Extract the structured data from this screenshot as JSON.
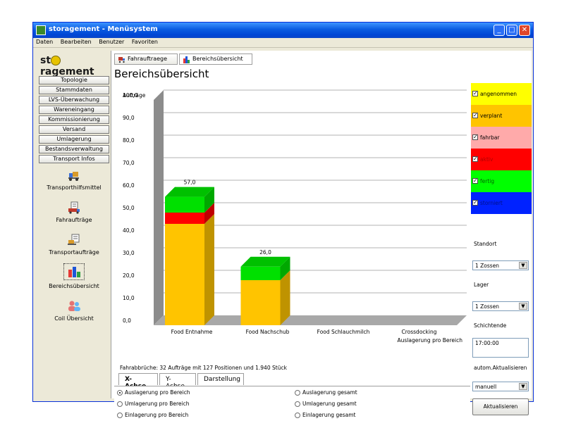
{
  "window": {
    "title": "storagement - Menüsystem",
    "minimize": "_",
    "maximize": "□",
    "close": "✕"
  },
  "menu": [
    "Daten",
    "Bearbeiten",
    "Benutzer",
    "Favoriten"
  ],
  "logo": {
    "text_left": "st",
    "text_right": "ragement"
  },
  "sidebar": {
    "buttons": [
      "Topologie",
      "Stammdaten",
      "LVS-Überwachung",
      "Wareneingang",
      "Kommissionierung",
      "Versand",
      "Umlagerung",
      "Bestandsverwaltung",
      "Transport Infos"
    ],
    "icon_items": [
      "Transporthilfsmittel",
      "Fahraufträge",
      "Transportaufträge",
      "Bereichsübersicht",
      "Coil Übersicht"
    ]
  },
  "tabs": [
    "Fahrauftraege",
    "Bereichsübersicht"
  ],
  "page_title": "Bereichsübersicht",
  "chart_data": {
    "type": "bar",
    "stacked": true,
    "ylabel": "Aufträge",
    "ylim": [
      0,
      100
    ],
    "yticks": [
      "0,0",
      "10,0",
      "20,0",
      "30,0",
      "40,0",
      "50,0",
      "60,0",
      "70,0",
      "80,0",
      "90,0",
      "100,0"
    ],
    "categories": [
      "Food Entnahme",
      "Food Nachschub",
      "Food Schlauchmilch",
      "Crossdocking"
    ],
    "x_axis_title": "Auslagerung pro Bereich",
    "totals": [
      "57,0",
      "26,0",
      "",
      ""
    ],
    "series": [
      {
        "name": "verplant",
        "color": "#ffc400",
        "values": [
          45,
          20,
          0,
          0
        ]
      },
      {
        "name": "aktiv",
        "color": "#ff0000",
        "values": [
          5,
          0,
          0,
          0
        ]
      },
      {
        "name": "fertig",
        "color": "#00e000",
        "values": [
          7,
          6,
          0,
          0
        ]
      }
    ],
    "grid": true,
    "legend_position": "right"
  },
  "footnote": "Fahrabbrüche: 32 Aufträge mit 127 Positionen und 1.940 Stück",
  "subtabs": [
    "X-Achse",
    "Y-Achse",
    "Darstellung"
  ],
  "radio_options": {
    "left": [
      "Auslagerung pro Bereich",
      "Umlagerung pro Bereich",
      "Einlagerung pro Bereich"
    ],
    "right": [
      "Auslagerung gesamt",
      "Umlagerung gesamt",
      "Einlagerung gesamt"
    ]
  },
  "legend": [
    {
      "label": "angenommen",
      "color": "#ffff00",
      "text_color": "#000000"
    },
    {
      "label": "verplant",
      "color": "#ffc400",
      "text_color": "#000000"
    },
    {
      "label": "fahrbar",
      "color": "#ffaaaa",
      "text_color": "#000000"
    },
    {
      "label": "aktiv",
      "color": "#ff0000",
      "text_color": "#b30000"
    },
    {
      "label": "fertig",
      "color": "#00ff00",
      "text_color": "#006600"
    },
    {
      "label": "storniert",
      "color": "#0022ff",
      "text_color": "#001188"
    }
  ],
  "right_panel": {
    "standort_label": "Standort",
    "standort_value": "1 Zossen",
    "lager_label": "Lager",
    "lager_value": "1 Zossen",
    "schicht_label": "Schichtende",
    "schicht_value": "17:00:00",
    "auto_label": "autom.Aktualisieren",
    "auto_value": "manuell",
    "refresh_label": "Aktualisieren"
  },
  "colors": {
    "titlebar": "#0a5be1",
    "bar_top_accent": "#00c000"
  }
}
